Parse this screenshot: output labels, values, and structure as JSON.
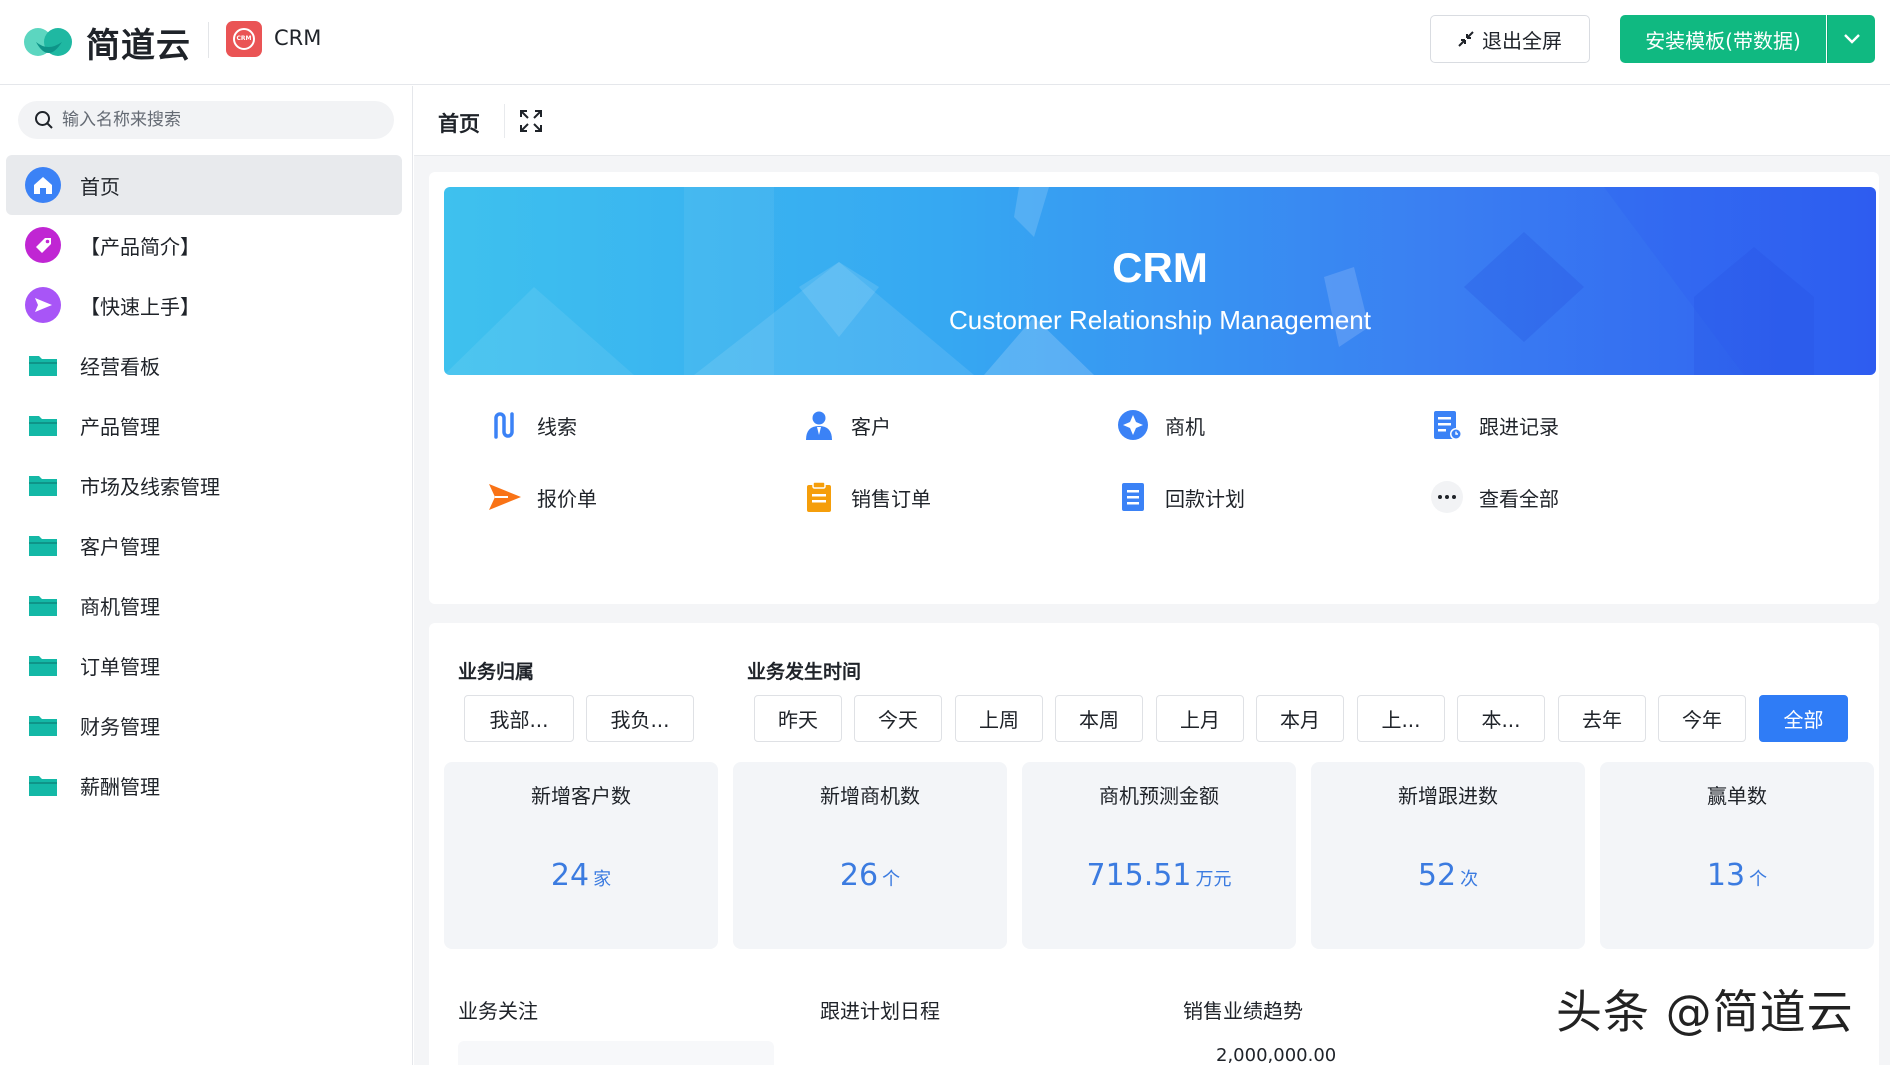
{
  "header": {
    "logo_text": "简道云",
    "app_badge": "CRM",
    "app_name": "CRM",
    "exit_fullscreen": "退出全屏",
    "install_template": "安装模板(带数据)"
  },
  "sidebar": {
    "search_placeholder": "输入名称来搜索",
    "items": [
      {
        "label": "首页"
      },
      {
        "label": "【产品简介】"
      },
      {
        "label": "【快速上手】"
      },
      {
        "label": "经营看板"
      },
      {
        "label": "产品管理"
      },
      {
        "label": "市场及线索管理"
      },
      {
        "label": "客户管理"
      },
      {
        "label": "商机管理"
      },
      {
        "label": "订单管理"
      },
      {
        "label": "财务管理"
      },
      {
        "label": "薪酬管理"
      }
    ]
  },
  "main": {
    "tab_title": "首页",
    "banner": {
      "title": "CRM",
      "subtitle": "Customer Relationship Management"
    },
    "quick_links": [
      {
        "label": "线索",
        "icon": "route-icon"
      },
      {
        "label": "客户",
        "icon": "person-icon"
      },
      {
        "label": "商机",
        "icon": "compass-icon"
      },
      {
        "label": "跟进记录",
        "icon": "record-icon"
      },
      {
        "label": "报价单",
        "icon": "send-icon"
      },
      {
        "label": "销售订单",
        "icon": "clipboard-icon"
      },
      {
        "label": "回款计划",
        "icon": "document-icon"
      },
      {
        "label": "查看全部",
        "icon": "more-icon"
      }
    ],
    "filters": {
      "owner_title": "业务归属",
      "owner_options": [
        "我部...",
        "我负..."
      ],
      "time_title": "业务发生时间",
      "time_options": [
        "昨天",
        "今天",
        "上周",
        "本周",
        "上月",
        "本月",
        "上...",
        "本...",
        "去年",
        "今年",
        "全部"
      ],
      "time_selected": "全部"
    },
    "stats": [
      {
        "label": "新增客户数",
        "value": "24",
        "unit": "家"
      },
      {
        "label": "新增商机数",
        "value": "26",
        "unit": "个"
      },
      {
        "label": "商机预测金额",
        "value": "715.51",
        "unit": "万元"
      },
      {
        "label": "新增跟进数",
        "value": "52",
        "unit": "次"
      },
      {
        "label": "赢单数",
        "value": "13",
        "unit": "个"
      }
    ],
    "sections": {
      "focus": "业务关注",
      "schedule": "跟进计划日程",
      "trend": "销售业绩趋势"
    },
    "trend_axis_top": "2,000,000.00"
  },
  "watermark": "头条 @简道云",
  "colors": {
    "brand_green": "#10b981",
    "active_blue": "#2f7cf6",
    "stat_blue": "#3b7be0",
    "folder_teal": "#14b8a6"
  }
}
